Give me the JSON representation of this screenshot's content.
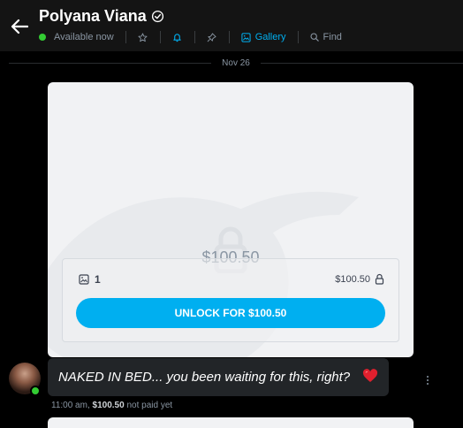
{
  "header": {
    "back_icon": "arrow-left-icon",
    "name": "Polyana Viana",
    "verified_icon": "verified-check-icon",
    "status": "Available now",
    "status_color": "#33cc33",
    "star_icon": "star-icon",
    "bell_icon": "bell-icon",
    "pin_icon": "pin-icon",
    "gallery_label": "Gallery",
    "gallery_icon": "image-icon",
    "find_label": "Find",
    "find_icon": "search-icon",
    "accent_color": "#00aff0"
  },
  "date_divider": "Nov 26",
  "locked_post": {
    "price": "$100.50",
    "lock_icon": "lock-icon",
    "media_icon": "image-icon",
    "media_count": "1",
    "box_price": "$100.50",
    "unlock_label": "UNLOCK FOR $100.50"
  },
  "message": {
    "text": "NAKED IN BED... you been waiting for this, right?",
    "emoji_icon": "heart-icon",
    "time": "11:00 am,",
    "price": "$100.50",
    "paid_status": "not paid yet",
    "more_icon": "more-vertical-icon"
  }
}
